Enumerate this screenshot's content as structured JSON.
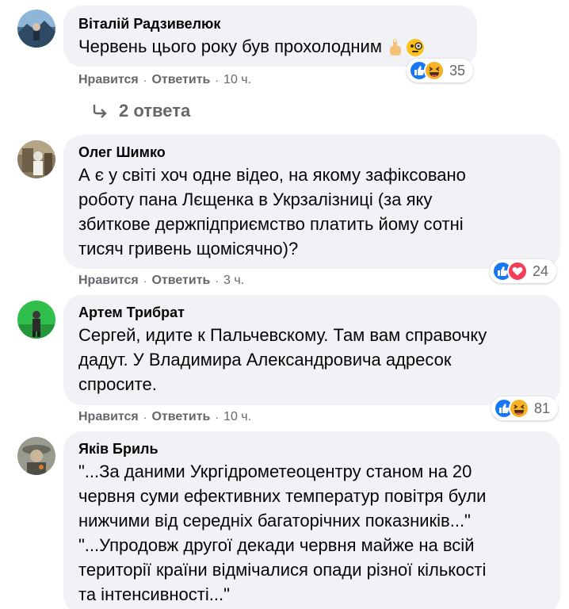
{
  "comments": [
    {
      "author": "Віталій Радзивелюк",
      "text": "Червень цього року був прохолодним",
      "inline_emojis": [
        "pointing-up-emoji",
        "face-with-monocle-emoji"
      ],
      "reactions": [
        "like",
        "haha"
      ],
      "reaction_count": "35",
      "like_label": "Нравится",
      "reply_label": "Ответить",
      "time": "10 ч.",
      "replies_label": "2 ответа"
    },
    {
      "author": "Олег Шимко",
      "text": "А є у світі хоч одне відео, на якому зафіксовано\nроботу пана Лєщенка в Укрзалізниці (за яку\nзбиткове держпідприємство платить йому сотні\nтисяч гривень щомісячно)?",
      "reactions": [
        "like",
        "love"
      ],
      "reaction_count": "24",
      "like_label": "Нравится",
      "reply_label": "Ответить",
      "time": "3 ч."
    },
    {
      "author": "Артем Трибрат",
      "text": "Сергей, идите к Пальчевскому. Там вам справочку\nдадут. У Владимира Александровича адресок\nспросите.",
      "reactions": [
        "like",
        "haha"
      ],
      "reaction_count": "81",
      "like_label": "Нравится",
      "reply_label": "Ответить",
      "time": "10 ч."
    },
    {
      "author": "Яків Бриль",
      "text": "\"...За даними Укргідрометеоцентру станом на 20\nчервня суми ефективних температур повітря були\nнижчими від середніх багаторічних показників...\"\n\"...Упродовж другої декади червня майже на всій\nтериторії країни відмічалися опади різної кількості\nта інтенсивності...\""
    }
  ],
  "colors": {
    "bubble": "#f0f2f5",
    "secondary_text": "#65676b",
    "like_blue": "#1877f2",
    "love_red": "#f33e58",
    "haha_yellow": "#f7b125"
  }
}
